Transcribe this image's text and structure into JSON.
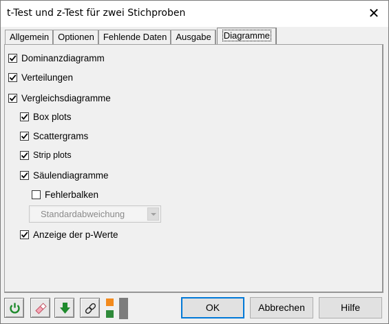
{
  "window": {
    "title": "t-Test und z-Test für zwei Stichproben",
    "close_glyph": "✕"
  },
  "tabs": [
    {
      "label": "Allgemein"
    },
    {
      "label": "Optionen"
    },
    {
      "label": "Fehlende Daten"
    },
    {
      "label": "Ausgabe"
    },
    {
      "label": "Diagramme",
      "active": true
    }
  ],
  "options": {
    "dominanz": {
      "label": "Dominanzdiagramm",
      "checked": true
    },
    "verteilungen": {
      "label": "Verteilungen",
      "checked": true
    },
    "vergleich": {
      "label": "Vergleichsdiagramme",
      "checked": true
    },
    "boxplots": {
      "label": "Box plots",
      "checked": true
    },
    "scatter": {
      "label": "Scattergrams",
      "checked": true
    },
    "strip": {
      "label": "Strip plots",
      "checked": true
    },
    "saeulen": {
      "label": "Säulendiagramme",
      "checked": true
    },
    "fehlerbalken": {
      "label": "Fehlerbalken",
      "checked": false
    },
    "pwerte": {
      "label": "Anzeige der p-Werte",
      "checked": true
    }
  },
  "combo": {
    "value": "Standardabweichung",
    "disabled": true
  },
  "toolbar": {
    "icons": [
      "refresh-icon",
      "eraser-icon",
      "download-arrow-icon",
      "link-icon"
    ],
    "colors": {
      "swatch1": "#f38a1c",
      "swatch2": "#2f8a3a",
      "bar": "#7d7d7d"
    }
  },
  "buttons": {
    "ok": "OK",
    "cancel": "Abbrechen",
    "help": "Hilfe"
  }
}
